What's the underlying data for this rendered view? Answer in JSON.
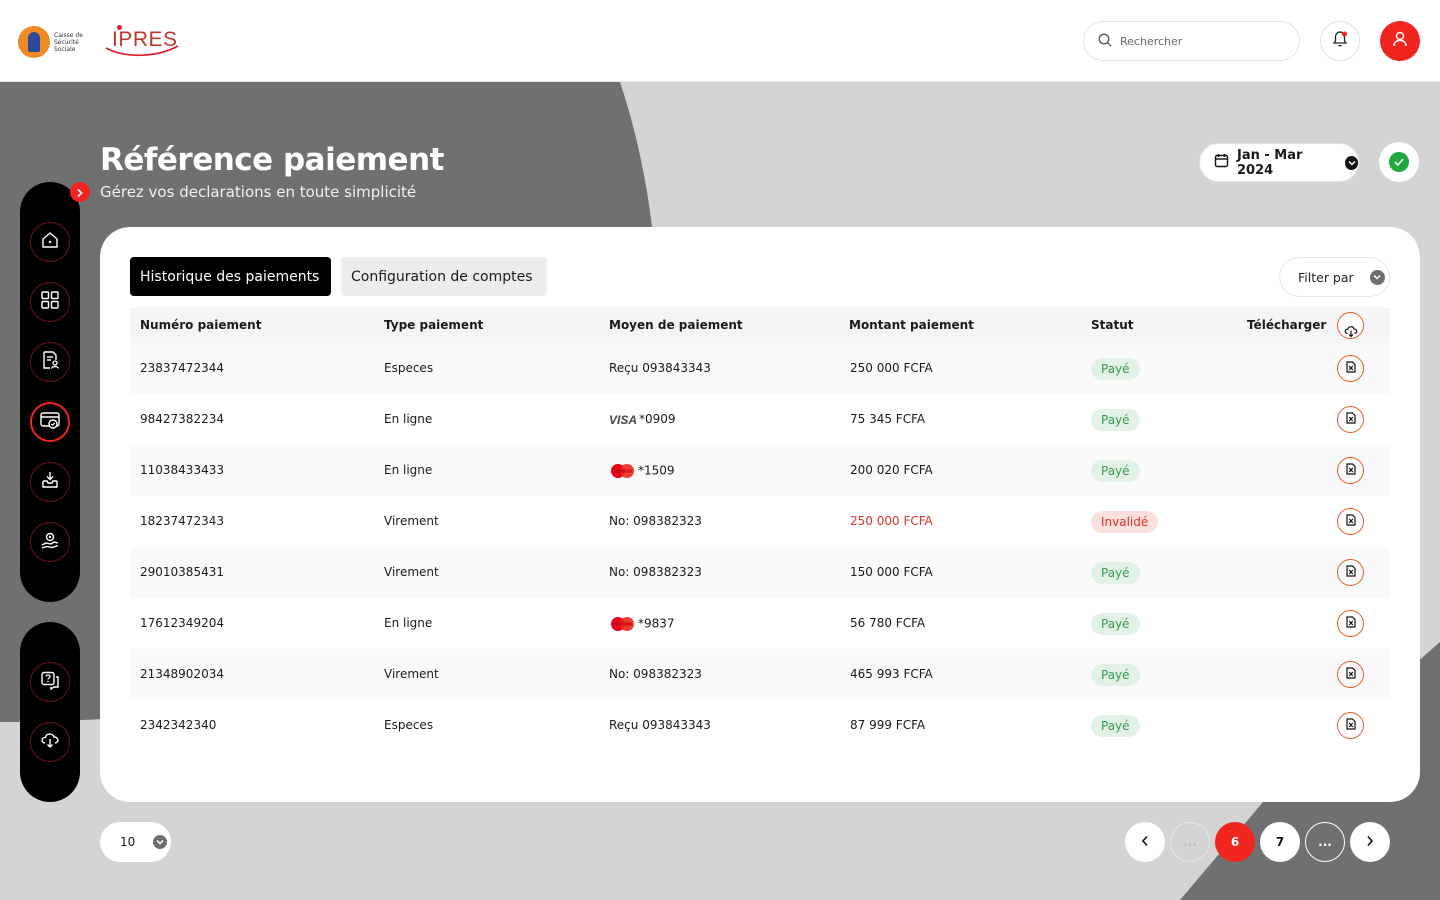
{
  "header": {
    "logo_css_text": "Caisse de Sécurité Sociale",
    "logo_ipres_text": "IPRES",
    "search_placeholder": "Rechercher"
  },
  "page": {
    "title": "Référence paiement",
    "subtitle": "Gérez vos declarations en toute simplicité",
    "date_range": "Jan - Mar 2024"
  },
  "sidebar": {
    "items": [
      "home-icon",
      "dashboard-icon",
      "document-user-icon",
      "payment-icon",
      "inbox-download-icon",
      "hand-gear-icon"
    ],
    "active": 3,
    "bottom_items": [
      "help-chat-icon",
      "cloud-download-icon"
    ]
  },
  "tabs": {
    "history": "Historique des paiements",
    "config": "Configuration de comptes"
  },
  "filter_label": "Filter par",
  "table": {
    "headers": {
      "numero": "Numéro paiement",
      "type": "Type paiement",
      "moyen": "Moyen de paiement",
      "montant": "Montant paiement",
      "statut": "Statut",
      "telecharger": "Télécharger"
    },
    "rows": [
      {
        "numero": "23837472344",
        "type": "Especes",
        "moyen": "Reçu 093843343",
        "card": "",
        "montant": "250 000 FCFA",
        "statut": "Payé"
      },
      {
        "numero": "98427382234",
        "type": "En ligne",
        "moyen": "*0909",
        "card": "VISA",
        "montant": "75 345 FCFA",
        "statut": "Payé"
      },
      {
        "numero": "11038433433",
        "type": "En ligne",
        "moyen": "*1509",
        "card": "MasterCard",
        "montant": "200 020 FCFA",
        "statut": "Payé"
      },
      {
        "numero": "18237472343",
        "type": "Virement",
        "moyen": "No: 098382323",
        "card": "",
        "montant": "250 000 FCFA",
        "statut": "Invalidé"
      },
      {
        "numero": "29010385431",
        "type": "Virement",
        "moyen": "No: 098382323",
        "card": "",
        "montant": "150 000 FCFA",
        "statut": "Payé"
      },
      {
        "numero": "17612349204",
        "type": "En ligne",
        "moyen": "*9837",
        "card": "MasterCard",
        "montant": "56 780 FCFA",
        "statut": "Payé"
      },
      {
        "numero": "21348902034",
        "type": "Virement",
        "moyen": "No: 098382323",
        "card": "",
        "montant": "465 993 FCFA",
        "statut": "Payé"
      },
      {
        "numero": "2342342340",
        "type": "Especes",
        "moyen": "Reçu 093843343",
        "card": "",
        "montant": "87 999 FCFA",
        "statut": "Payé"
      }
    ]
  },
  "pagination": {
    "per_page": "10",
    "pages": [
      "...",
      "6",
      "7",
      "..."
    ],
    "current": "6"
  },
  "colors": {
    "accent": "#f0261e",
    "success": "#3a9a4e",
    "danger": "#e0332a",
    "dark_bg": "#707070"
  }
}
